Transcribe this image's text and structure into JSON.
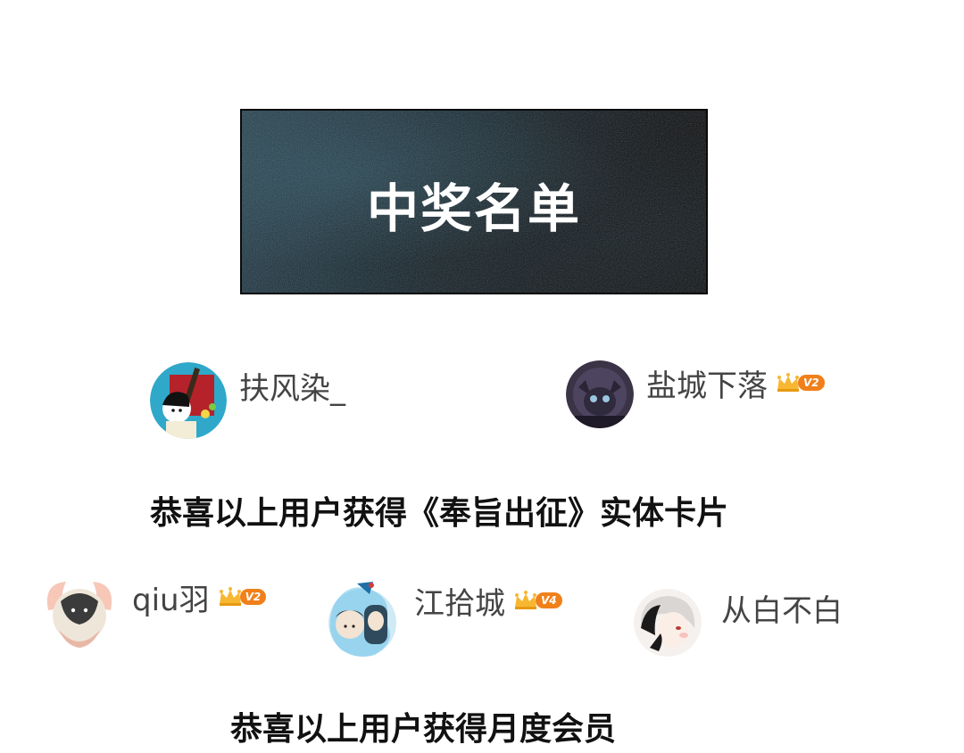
{
  "banner": {
    "title": "中奖名单"
  },
  "group_one": {
    "users": [
      {
        "name": "扶风染_",
        "avatar": "guitar-boy-avatar-icon",
        "badge": null
      },
      {
        "name": "盐城下落",
        "avatar": "dark-creature-avatar-icon",
        "badge": "V2"
      }
    ],
    "caption": "恭喜以上用户获得《奉旨出征》实体卡片"
  },
  "group_two": {
    "users": [
      {
        "name": "qiu羽",
        "avatar": "winged-lion-avatar-icon",
        "badge": "V2"
      },
      {
        "name": "江拾城",
        "avatar": "blue-couple-avatar-icon",
        "badge": "V4"
      },
      {
        "name": "从白不白",
        "avatar": "white-hair-girl-avatar-icon",
        "badge": null
      }
    ],
    "caption": "恭喜以上用户获得月度会员"
  },
  "colors": {
    "badge_orange": "#f0801a",
    "crown_gold": "#f7b731",
    "banner_dark": "#06090c",
    "banner_teal": "#1d3a48"
  }
}
